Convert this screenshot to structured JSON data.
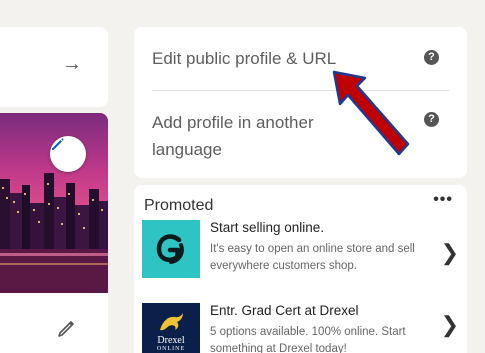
{
  "profile_card": {
    "row1_label": "Edit public profile & URL",
    "row2_label": "Add profile in another language",
    "help_glyph": "?"
  },
  "promoted": {
    "title": "Promoted",
    "more_glyph": "•••",
    "ads": [
      {
        "headline": "Start selling online.",
        "body": "It's easy to open an online store and sell everywhere customers shop."
      },
      {
        "headline": "Entr. Grad Cert at Drexel",
        "body": "5 options available. 100% online. Start something at Drexel today!",
        "logo_name": "Drexel",
        "logo_sub": "ONLINE"
      }
    ]
  },
  "glyphs": {
    "arrow_right": "→",
    "chevron": "❯"
  },
  "colors": {
    "annotation_arrow": "#c00000",
    "annotation_outline": "#1f3a93",
    "help_icon": "#555555"
  }
}
